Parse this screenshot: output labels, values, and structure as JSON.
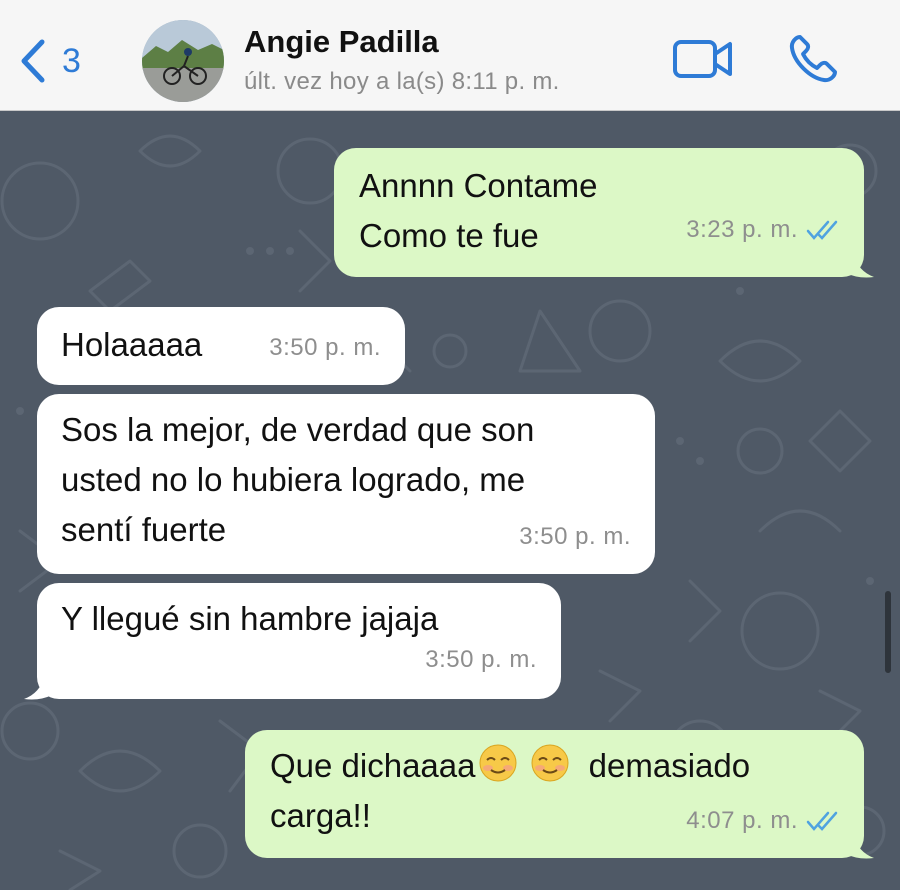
{
  "header": {
    "back_count": "3",
    "contact_name": "Angie Padilla",
    "last_seen": "últ. vez hoy a la(s) 8:11 p. m."
  },
  "colors": {
    "accent": "#2e7bd6",
    "outgoing_bubble": "#dcf8c6",
    "incoming_bubble": "#ffffff",
    "chat_background": "#4f5966",
    "read_ticks": "#4fa3e0"
  },
  "messages": [
    {
      "direction": "out",
      "text": "Annnn Contame\nComo te fue",
      "time": "3:23 p. m.",
      "status": "read"
    },
    {
      "direction": "in",
      "text": "Holaaaaa",
      "time": "3:50 p. m."
    },
    {
      "direction": "in",
      "text": "Sos la mejor, de verdad que son\nusted no lo hubiera logrado, me\nsentí fuerte",
      "time": "3:50 p. m."
    },
    {
      "direction": "in",
      "text": "Y llegué sin hambre jajaja",
      "time": "3:50 p. m."
    },
    {
      "direction": "out",
      "text_before": "Que dichaaaa",
      "emoji": [
        "smiling-face-icon",
        "smiling-face-icon"
      ],
      "text_after": " demasiado",
      "text_line2": "carga!!",
      "time": "4:07 p. m.",
      "status": "read"
    }
  ]
}
